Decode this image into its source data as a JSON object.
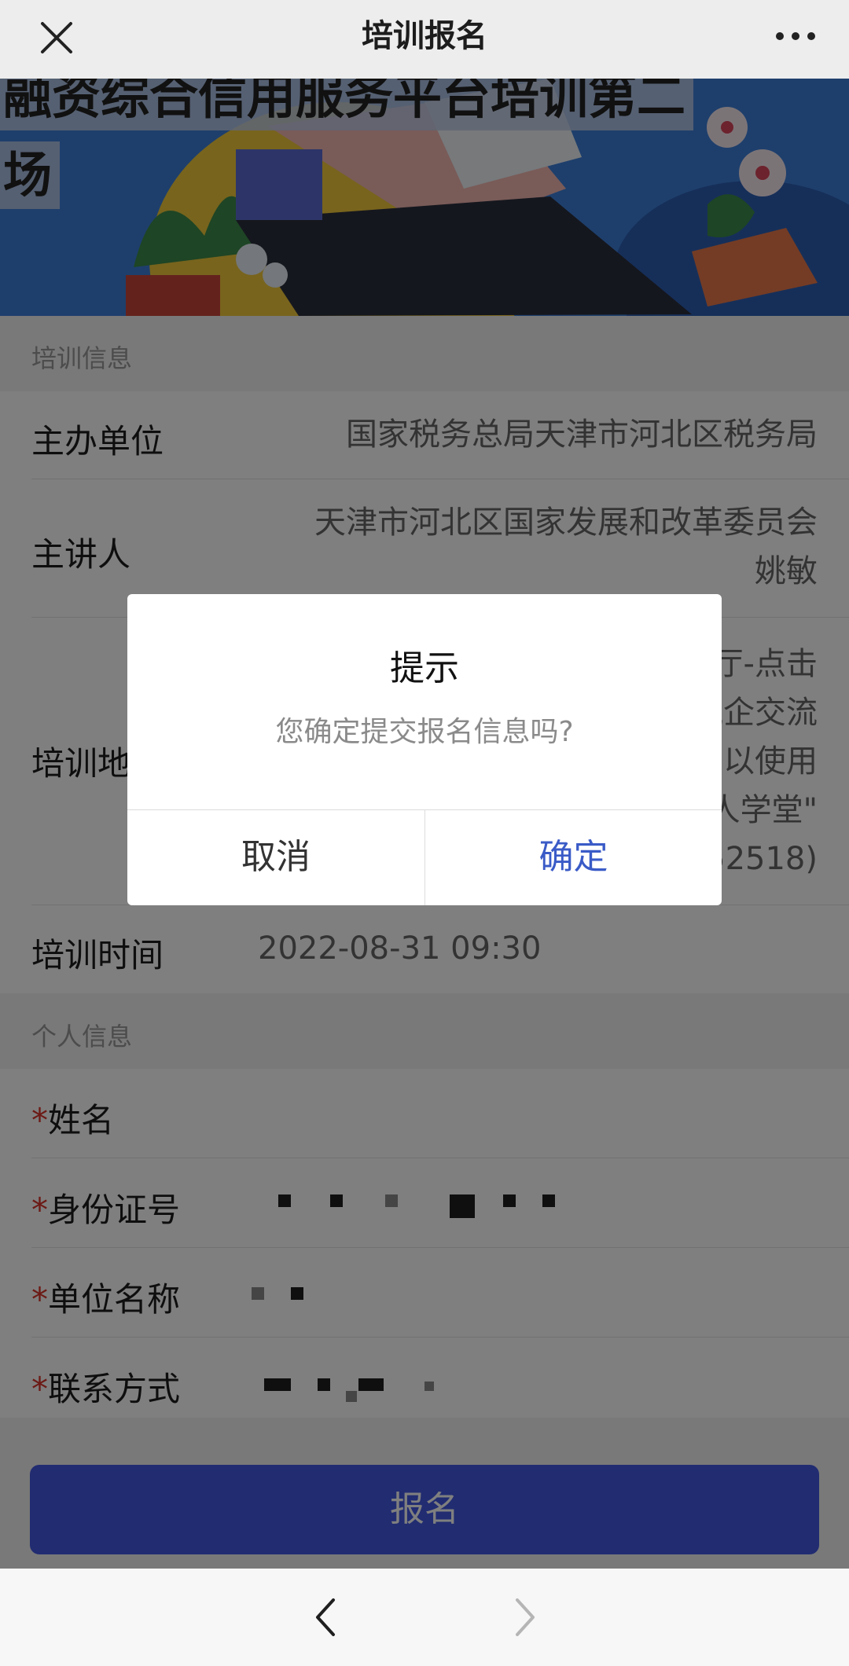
{
  "header": {
    "title": "培训报名"
  },
  "banner": {
    "title_line1": "融资综合信用服务平台培训第二",
    "title_line2": "场"
  },
  "training_info": {
    "section_label": "培训信息",
    "organizer": {
      "label": "主办单位",
      "value": "国家税务总局天津市河北区税务局"
    },
    "speaker": {
      "label": "主讲人",
      "value_line1": "天津市河北区国家发展和改革委员会",
      "value_line2": "姚敏"
    },
    "location": {
      "label": "培训地点",
      "value_lines": [
        "天津税务公众号-我的-互动厅-点击",
        "\"天津税务云课堂\"-选择\"税企交流",
        "互动\"-注册并登录即可（可以使用",
        "\"天津税务\"APP-\"纳税人学堂\"",
        "会议号：（直播号：552518)"
      ]
    },
    "time": {
      "label": "培训时间",
      "value": "2022-08-31 09:30"
    }
  },
  "personal_info": {
    "section_label": "个人信息",
    "required_mark": "*",
    "name": {
      "label": "姓名"
    },
    "id_number": {
      "label": "身份证号"
    },
    "company": {
      "label": "单位名称"
    },
    "contact": {
      "label": "联系方式"
    }
  },
  "submit": {
    "label": "报名"
  },
  "dialog": {
    "title": "提示",
    "message": "您确定提交报名信息吗?",
    "cancel": "取消",
    "confirm": "确定"
  },
  "colors": {
    "primary": "#4258e3",
    "confirm_text": "#3a5bc7",
    "required": "#d9342b"
  },
  "icons": {
    "close": "close-icon",
    "more": "more-icon",
    "back": "chevron-left-icon",
    "forward": "chevron-right-icon"
  }
}
